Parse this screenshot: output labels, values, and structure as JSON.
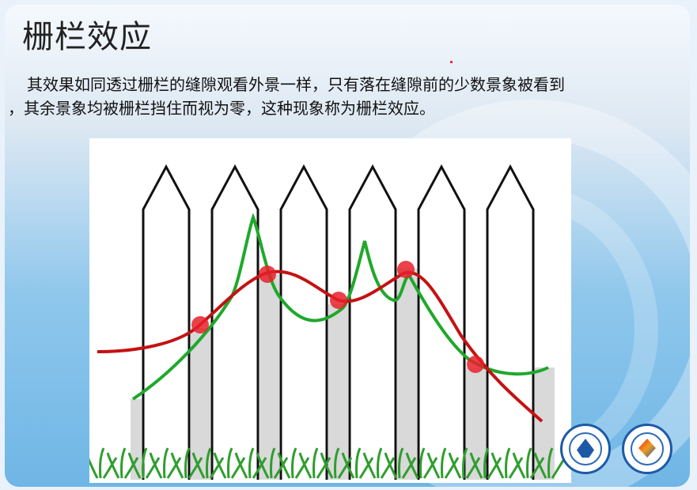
{
  "slide": {
    "title": "栅栏效应",
    "paragraph_line1": "其效果如同透过栅栏的缝隙观看外景一样，只有落在缝隙前的少数景象被看到",
    "paragraph_line2": "，其余景象均被栅栏挡住而视为零，这种现象称为栅栏效应。"
  },
  "figure": {
    "fence_picket_count": 6,
    "colors": {
      "true_spectrum": "#e01a1a",
      "sampled_spectrum": "#1fa82b",
      "sample_points": "#e8202a",
      "gap_fill": "#d9d9d9",
      "picket_stroke": "#111111"
    },
    "icons": [
      "fence-icon",
      "grass-icon"
    ]
  },
  "logos": [
    "university-emblem-icon",
    "institute-emblem-icon"
  ]
}
